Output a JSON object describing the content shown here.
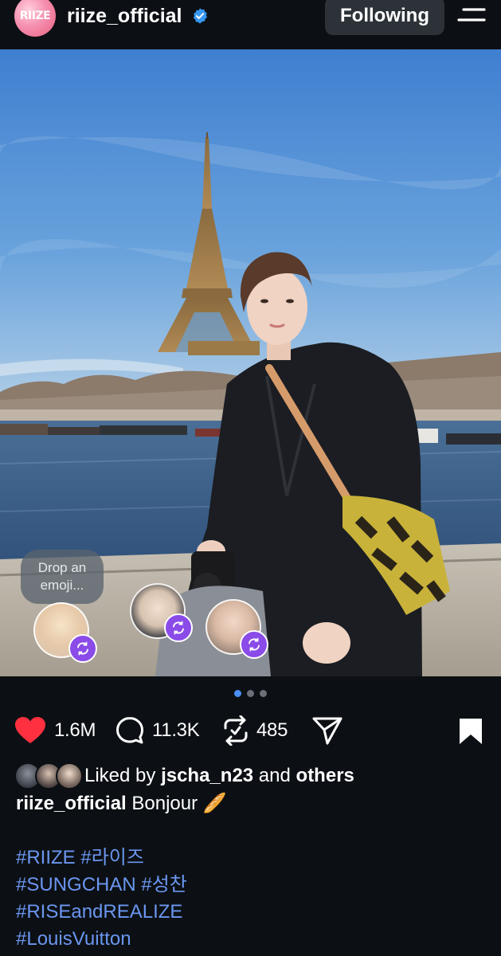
{
  "header": {
    "avatar_text": "RIIZE",
    "username": "riize_official",
    "follow_label": "Following"
  },
  "photo": {
    "emoji_prompt": "Drop an emoji..."
  },
  "carousel": {
    "count": 3,
    "active_index": 0
  },
  "actions": {
    "likes": "1.6M",
    "comments": "11.3K",
    "reposts": "485"
  },
  "liked_by": {
    "prefix": "Liked by ",
    "user": "jscha_n23",
    "middle": " and ",
    "others": "others"
  },
  "caption": {
    "username": "riize_official",
    "text": "Bonjour",
    "emoji": "🥖"
  },
  "hashtags": [
    "#RIIZE #라이즈",
    "#SUNGCHAN #성찬",
    "#RISEandREALIZE",
    "#LouisVuitton"
  ],
  "colors": {
    "background": "#0c1014",
    "verified": "#3897f0",
    "like": "#ff3040",
    "hashtag": "#6b96f0",
    "repost_badge": "#8a4be8"
  },
  "icons": {
    "verified": "verified-badge-icon",
    "menu": "menu-icon",
    "like": "heart-filled-icon",
    "comment": "comment-icon",
    "repost": "repost-icon",
    "share": "paper-plane-icon",
    "save": "bookmark-filled-icon"
  }
}
